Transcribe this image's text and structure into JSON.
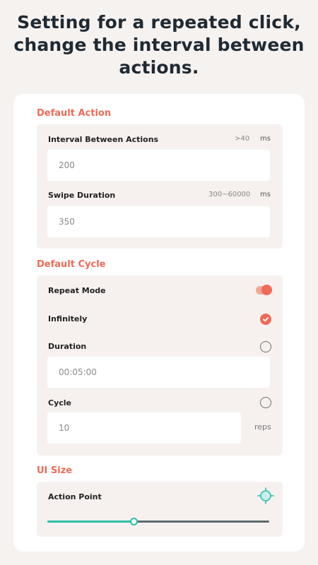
{
  "headline": "Setting for a repeated click, change the interval between actions.",
  "colors": {
    "accent": "#ee6b55",
    "slider": "#2bbfa7",
    "panel": "#f6f1ef"
  },
  "default_action": {
    "title": "Default Action",
    "interval": {
      "label": "Interval Between Actions",
      "hint": ">40",
      "unit": "ms",
      "value": "200"
    },
    "swipe": {
      "label": "Swipe Duration",
      "hint": "300~60000",
      "unit": "ms",
      "value": "350"
    }
  },
  "default_cycle": {
    "title": "Default Cycle",
    "repeat_mode": {
      "label": "Repeat Mode",
      "on": true
    },
    "infinitely": {
      "label": "Infinitely",
      "selected": true
    },
    "duration": {
      "label": "Duration",
      "selected": false,
      "value": "00:05:00"
    },
    "cycle": {
      "label": "Cycle",
      "selected": false,
      "value": "10",
      "unit": "reps"
    }
  },
  "ui_size": {
    "title": "UI Size",
    "action_point": {
      "label": "Action Point",
      "icon": "target-icon",
      "slider_value": 0.39
    }
  }
}
